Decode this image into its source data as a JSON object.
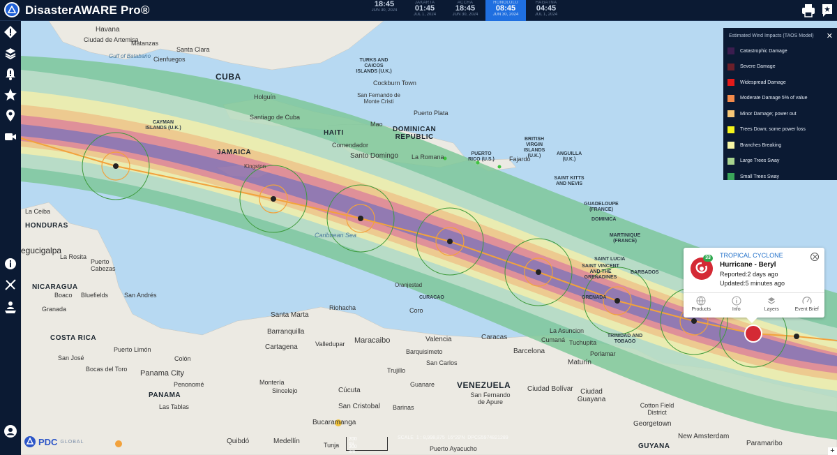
{
  "app": {
    "title": "DisasterAWARE Pro®"
  },
  "clocks": [
    {
      "city": "",
      "time": "18:45",
      "date": "JUN 30, 2024",
      "active": false
    },
    {
      "city": "JAKARTA",
      "time": "01:45",
      "date": "JUL 1, 2024",
      "active": false
    },
    {
      "city": "ACCRA",
      "time": "18:45",
      "date": "JUN 30, 2024",
      "active": false
    },
    {
      "city": "HONOLULU",
      "time": "08:45",
      "date": "JUN 30, 2024",
      "active": true
    },
    {
      "city": "HAGATNA",
      "time": "04:45",
      "date": "JUL 1, 2024",
      "active": false
    }
  ],
  "toolbar": {
    "print_icon": "print-icon",
    "bookmark_icon": "bookmark-icon"
  },
  "sidebar": {
    "items": [
      {
        "name": "hazard-icon"
      },
      {
        "name": "layers-icon"
      },
      {
        "name": "alert-icon"
      },
      {
        "name": "star-icon"
      },
      {
        "name": "location-icon"
      },
      {
        "name": "video-icon"
      },
      {
        "name": "info-icon"
      },
      {
        "name": "route-icon"
      },
      {
        "name": "map-user-icon"
      },
      {
        "name": "user-icon"
      }
    ]
  },
  "legend": {
    "title": "Estimated Wind Impacts (TAOS Model)",
    "items": [
      {
        "label": "Catastrophic Damage",
        "color": "#3b1d4f"
      },
      {
        "label": "Severe Damage",
        "color": "#6b1f2a"
      },
      {
        "label": "Widespread Damage",
        "color": "#e21a1a"
      },
      {
        "label": "Moderate Damage 5% of value",
        "color": "#f28a4b"
      },
      {
        "label": "Minor Damage; power out",
        "color": "#f6c777"
      },
      {
        "label": "Trees Down; some power loss",
        "color": "#f4f41c"
      },
      {
        "label": "Branches Breaking",
        "color": "#f6f6a6"
      },
      {
        "label": "Large Trees Sway",
        "color": "#a7d38f"
      },
      {
        "label": "Small Trees Sway",
        "color": "#3aa65a"
      }
    ]
  },
  "popup": {
    "badge": "33",
    "type": "TROPICAL CYCLONE",
    "name": "Hurricane - Beryl",
    "reported": "Reported:2 days ago",
    "updated": "Updated:5 minutes ago",
    "actions": [
      {
        "label": "Products",
        "icon": "globe-icon"
      },
      {
        "label": "Info",
        "icon": "info-icon"
      },
      {
        "label": "Layers",
        "icon": "layers-icon"
      },
      {
        "label": "Event Brief",
        "icon": "speedometer-icon"
      }
    ]
  },
  "map_labels": {
    "countries": [
      "CUBA",
      "HAITI",
      "DOMINICAN\nREPUBLIC",
      "JAMAICA",
      "HONDURAS",
      "NICARAGUA",
      "COSTA RICA",
      "PANAMA",
      "VENEZUELA",
      "GUYANA"
    ],
    "places": [
      "Havana",
      "Ciudad de Artemisa",
      "Matanzas",
      "Santa Clara",
      "Cienfuegos",
      "Gulf of Batabano",
      "Holguín",
      "Santiago de Cuba",
      "TURKS AND CAICOS ISLANDS (U.K.)",
      "Cockburn Town",
      "San Fernando de Monte Cristi",
      "Puerto Plata",
      "Mao",
      "Comendador",
      "Santo Domingo",
      "La Romana",
      "PUERTO RICO (U.S.)",
      "Fajardo",
      "BRITISH VIRGIN ISLANDS (U.K.)",
      "ANGUILLA (U.K.)",
      "SAINT KITTS AND NEVIS",
      "GUADELOUPE (FRANCE)",
      "DOMINICA",
      "MARTINIQUE (FRANCE)",
      "SAINT LUCIA",
      "SAINT VINCENT AND THE GRENADINES",
      "BARBADOS",
      "GRENADA",
      "TRINIDAD AND TOBAGO",
      "CAYMAN ISLANDS (U.K.)",
      "Kingston",
      "Caribbean Sea",
      "La Ceiba",
      "egucigalpa",
      "La Rosita",
      "Puerto Cabezas",
      "Bluefields",
      "Boaco",
      "Granada",
      "San Andrés",
      "Puerto Limón",
      "San José",
      "Bocas del Toro",
      "Panama City",
      "Penonomé",
      "Las Tablas",
      "Colón",
      "Oranjestad",
      "CURACAO",
      "Coro",
      "Riohacha",
      "Santa Marta",
      "Barranquilla",
      "Cartagena",
      "Valledupar",
      "Maracaibo",
      "Valencia",
      "Caracas",
      "Barquisimeto",
      "San Carlos",
      "Trujillo",
      "Guanare",
      "Barcelona",
      "Maturín",
      "La Asuncion",
      "Cumaná",
      "Porlamar",
      "San Fernando de Apure",
      "Ciudad Bolívar",
      "Ciudad Guayana",
      "Sincelejo",
      "Montería",
      "Cúcuta",
      "San Cristobal",
      "Bucaramanga",
      "Barinas",
      "Puerto Ayacucho",
      "Quibdó",
      "Medellín",
      "Tunja",
      "Cotton Field District",
      "Georgetown",
      "New Amsterdam",
      "Paramaribo",
      "Tuchupita"
    ]
  },
  "footer": {
    "brand": "PDC",
    "brand_sub": "GLOBAL",
    "scale_top": "200 mi",
    "scale_bottom": "300 km",
    "scale_label": "SCALE",
    "scale_value": "1 : 8,998,875",
    "coords": "16°29'N",
    "ref": "DPCS5974821289"
  }
}
